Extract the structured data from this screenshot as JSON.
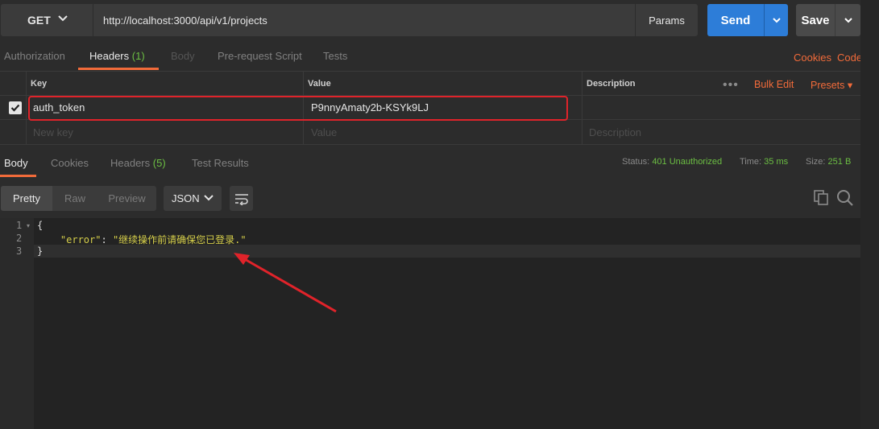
{
  "request": {
    "method": "GET",
    "url": "http://localhost:3000/api/v1/projects",
    "params_label": "Params",
    "send_label": "Send",
    "save_label": "Save"
  },
  "request_tabs": {
    "authorization": "Authorization",
    "headers": "Headers",
    "headers_count": "(1)",
    "body": "Body",
    "prerequest": "Pre-request Script",
    "tests": "Tests",
    "cookies": "Cookies",
    "code": "Code"
  },
  "headers_table": {
    "columns": {
      "key": "Key",
      "value": "Value",
      "description": "Description"
    },
    "bulk_edit": "Bulk Edit",
    "presets": "Presets",
    "rows": [
      {
        "key": "auth_token",
        "value": "P9nnyAmaty2b-KSYk9LJ",
        "description": "",
        "checked": true
      }
    ],
    "placeholders": {
      "key": "New key",
      "value": "Value",
      "description": "Description"
    }
  },
  "response_tabs": {
    "body": "Body",
    "cookies": "Cookies",
    "headers": "Headers",
    "headers_count": "(5)",
    "test_results": "Test Results"
  },
  "response_meta": {
    "status_label": "Status:",
    "status_value": "401 Unauthorized",
    "time_label": "Time:",
    "time_value": "35 ms",
    "size_label": "Size:",
    "size_value": "251 B"
  },
  "response_toolbar": {
    "pretty": "Pretty",
    "raw": "Raw",
    "preview": "Preview",
    "format": "JSON"
  },
  "response_body": {
    "line_numbers": [
      "1",
      "2",
      "3"
    ],
    "open_brace": "{",
    "key": "\"error\"",
    "colon": ": ",
    "value": "\"继续操作前请确保您已登录.\"",
    "close_brace": "}"
  },
  "colors": {
    "accent_orange": "#f26b3a",
    "send_blue": "#2d7dd8",
    "status_green": "#6cbf43",
    "annotation_red": "#e0232a"
  }
}
